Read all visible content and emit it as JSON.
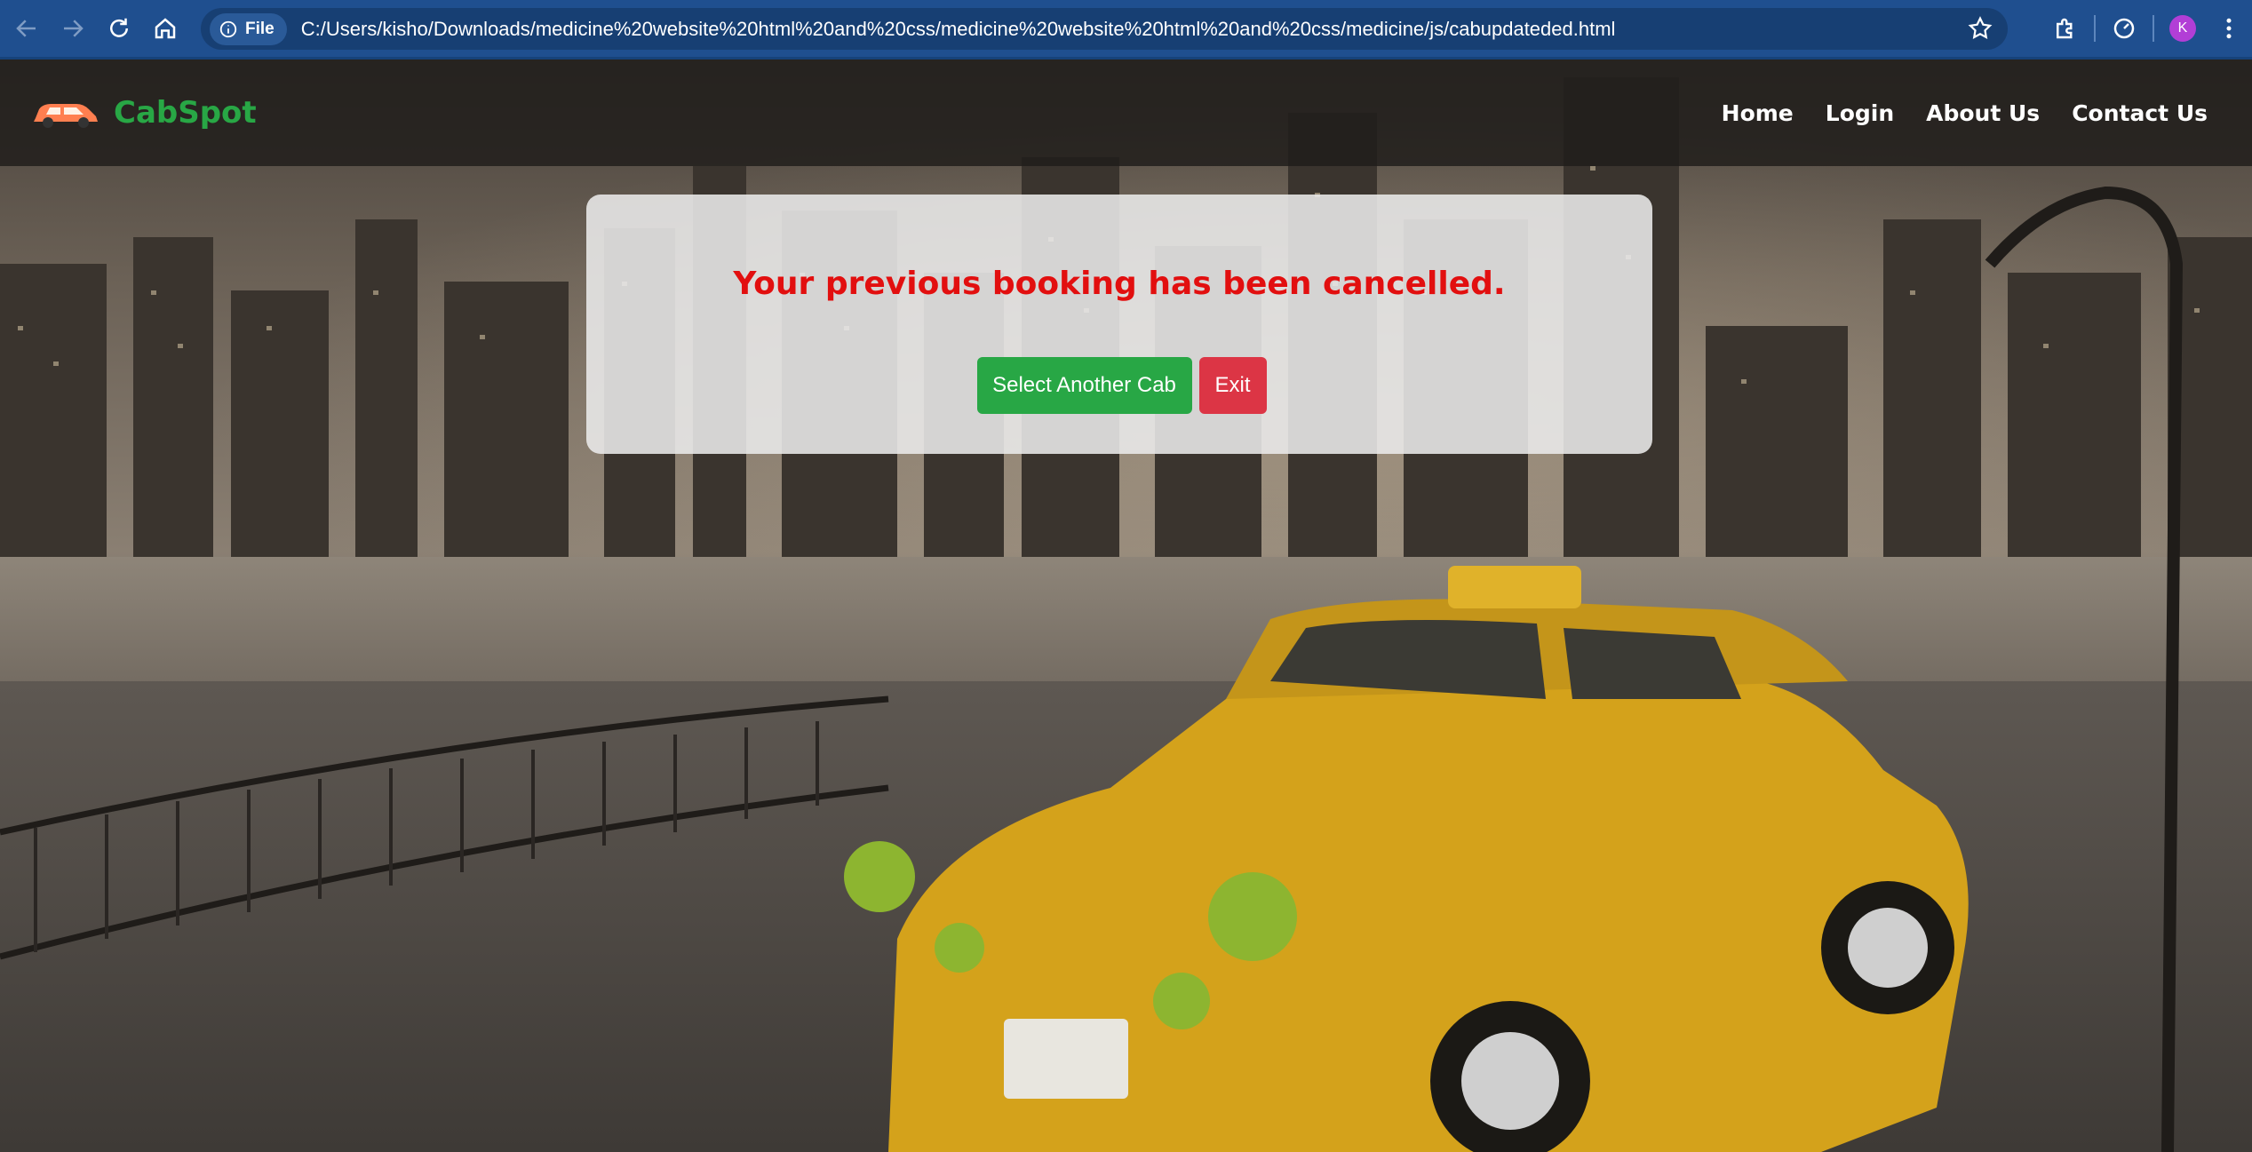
{
  "browser": {
    "file_label": "File",
    "url": "C:/Users/kisho/Downloads/medicine%20website%20html%20and%20css/medicine%20website%20html%20and%20css/medicine/js/cabupdateded.html",
    "profile_initial": "K"
  },
  "site": {
    "brand": "CabSpot",
    "brand_color": "#28a745",
    "nav": [
      "Home",
      "Login",
      "About Us",
      "Contact Us"
    ]
  },
  "notice": {
    "message": "Your previous booking has been cancelled.",
    "message_color": "#e20f0f",
    "primary_button": "Select Another Cab",
    "secondary_button": "Exit"
  }
}
